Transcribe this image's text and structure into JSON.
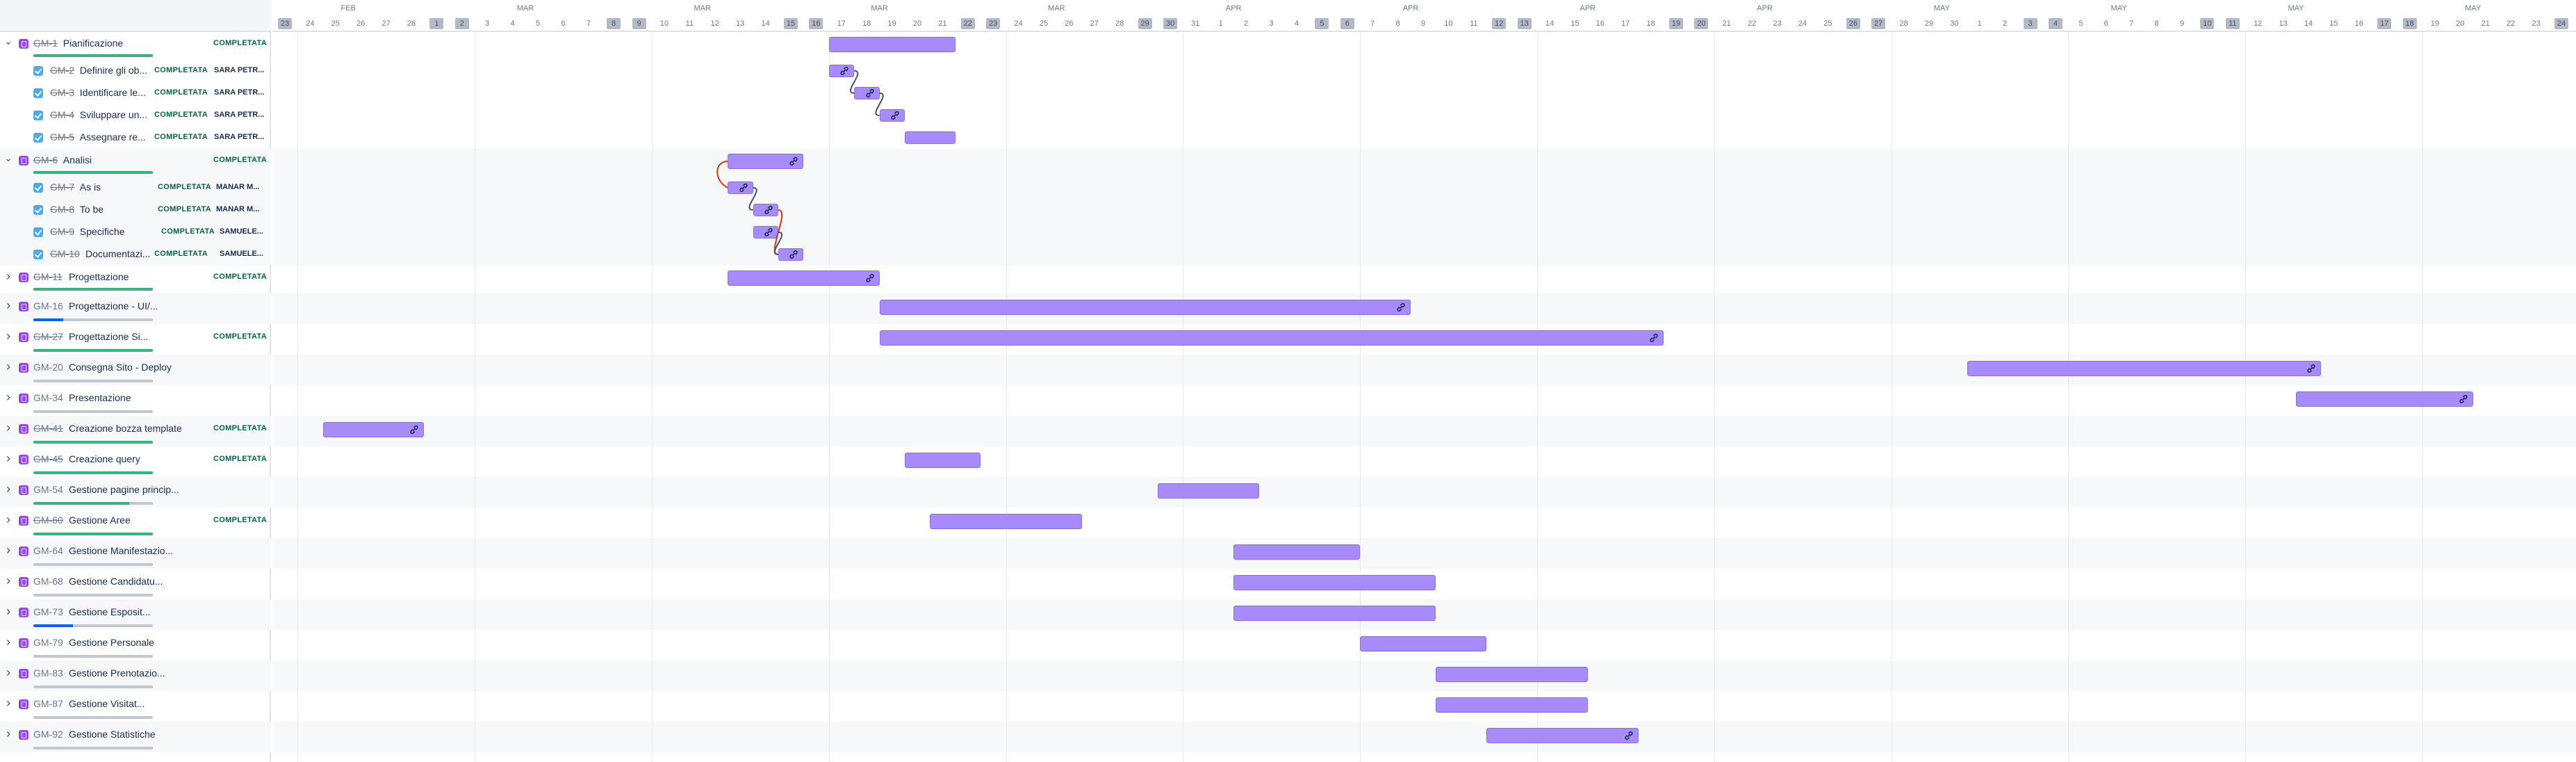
{
  "timeline": {
    "months": [
      "FEB",
      "MAR",
      "MAR",
      "MAR",
      "APR",
      "APR",
      "APR",
      "MAY",
      "MAY",
      "MAY"
    ],
    "days": [
      "23",
      "24",
      "25",
      "26",
      "27",
      "28",
      "1",
      "2",
      "3",
      "4",
      "5",
      "6",
      "7",
      "8",
      "9",
      "10",
      "11",
      "12",
      "13",
      "14",
      "15",
      "16",
      "17",
      "18",
      "19",
      "20",
      "21",
      "22",
      "23",
      "24",
      "25",
      "26",
      "27",
      "28",
      "29",
      "30",
      "31",
      "1",
      "2",
      "3",
      "4",
      "5",
      "6",
      "7",
      "8",
      "9",
      "10",
      "11",
      "12",
      "13",
      "14",
      "15",
      "16",
      "17",
      "18",
      "19",
      "20",
      "21",
      "22",
      "23",
      "24",
      "25",
      "26",
      "27",
      "28",
      "29",
      "30",
      "1",
      "2",
      "3",
      "4",
      "5",
      "6",
      "7",
      "8",
      "9",
      "10",
      "11",
      "12",
      "13",
      "14",
      "15",
      "16",
      "17",
      "18",
      "19",
      "20",
      "21",
      "22",
      "23",
      "24"
    ]
  },
  "issues": [
    {
      "key": "GM-1",
      "title": "Pianificazione",
      "status": "COMPLETATA",
      "assignee": "",
      "level": 0,
      "expanded": true,
      "resolved": true,
      "progress": 1.0
    },
    {
      "key": "GM-2",
      "title": "Definire gli ob...",
      "status": "COMPLETATA",
      "assignee": "SARA PETR...",
      "level": 1,
      "resolved": true
    },
    {
      "key": "GM-3",
      "title": "Identificare le...",
      "status": "COMPLETATA",
      "assignee": "SARA PETR...",
      "level": 1,
      "resolved": true
    },
    {
      "key": "GM-4",
      "title": "Sviluppare un...",
      "status": "COMPLETATA",
      "assignee": "SARA PETR...",
      "level": 1,
      "resolved": true
    },
    {
      "key": "GM-5",
      "title": "Assegnare re...",
      "status": "COMPLETATA",
      "assignee": "SARA PETR...",
      "level": 1,
      "resolved": true
    },
    {
      "key": "GM-6",
      "title": "Analisi",
      "status": "COMPLETATA",
      "assignee": "",
      "level": 0,
      "expanded": true,
      "resolved": true,
      "progress": 1.0
    },
    {
      "key": "GM-7",
      "title": "As is",
      "status": "COMPLETATA",
      "assignee": "MANAR M...",
      "level": 1,
      "resolved": true
    },
    {
      "key": "GM-8",
      "title": "To be",
      "status": "COMPLETATA",
      "assignee": "MANAR M...",
      "level": 1,
      "resolved": true
    },
    {
      "key": "GM-9",
      "title": "Specifiche",
      "status": "COMPLETATA",
      "assignee": "SAMUELE...",
      "level": 1,
      "resolved": true
    },
    {
      "key": "GM-10",
      "title": "Documentazi...",
      "status": "COMPLETATA",
      "assignee": "SAMUELE...",
      "level": 1,
      "resolved": true
    },
    {
      "key": "GM-11",
      "title": "Progettazione",
      "status": "COMPLETATA",
      "assignee": "",
      "level": 0,
      "expanded": false,
      "resolved": true,
      "progress": 1.0
    },
    {
      "key": "GM-16",
      "title": "Progettazione - UI/...",
      "status": "",
      "assignee": "",
      "level": 0,
      "expanded": false,
      "resolved": false,
      "progress": 0.25,
      "progress_color": "blue"
    },
    {
      "key": "GM-27",
      "title": "Progettazione Si...",
      "status": "COMPLETATA",
      "assignee": "",
      "level": 0,
      "expanded": false,
      "resolved": true,
      "progress": 1.0
    },
    {
      "key": "GM-20",
      "title": "Consegna Sito - Deploy",
      "status": "",
      "assignee": "",
      "level": 0,
      "expanded": false,
      "resolved": false,
      "progress": 0
    },
    {
      "key": "GM-34",
      "title": "Presentazione",
      "status": "",
      "assignee": "",
      "level": 0,
      "expanded": false,
      "resolved": false,
      "progress": 0
    },
    {
      "key": "GM-41",
      "title": "Creazione bozza template",
      "status": "COMPLETATA",
      "assignee": "",
      "level": 0,
      "expanded": false,
      "resolved": true,
      "progress": 1.0
    },
    {
      "key": "GM-45",
      "title": "Creazione query",
      "status": "COMPLETATA",
      "assignee": "",
      "level": 0,
      "expanded": false,
      "resolved": true,
      "progress": 1.0
    },
    {
      "key": "GM-54",
      "title": "Gestione pagine princip...",
      "status": "",
      "assignee": "",
      "level": 0,
      "expanded": false,
      "resolved": false,
      "progress": 0.8
    },
    {
      "key": "GM-60",
      "title": "Gestione Aree",
      "status": "COMPLETATA",
      "assignee": "",
      "level": 0,
      "expanded": false,
      "resolved": true,
      "progress": 1.0
    },
    {
      "key": "GM-64",
      "title": "Gestione Manifestazio...",
      "status": "",
      "assignee": "",
      "level": 0,
      "expanded": false,
      "resolved": false,
      "progress": 0
    },
    {
      "key": "GM-68",
      "title": "Gestione Candidatu...",
      "status": "",
      "assignee": "",
      "level": 0,
      "expanded": false,
      "resolved": false,
      "progress": 0
    },
    {
      "key": "GM-73",
      "title": "Gestione Esposit...",
      "status": "",
      "assignee": "",
      "level": 0,
      "expanded": false,
      "resolved": false,
      "progress": 0.33,
      "progress_color": "blue"
    },
    {
      "key": "GM-79",
      "title": "Gestione Personale",
      "status": "",
      "assignee": "",
      "level": 0,
      "expanded": false,
      "resolved": false,
      "progress": 0
    },
    {
      "key": "GM-83",
      "title": "Gestione Prenotazio...",
      "status": "",
      "assignee": "",
      "level": 0,
      "expanded": false,
      "resolved": false,
      "progress": 0
    },
    {
      "key": "GM-87",
      "title": "Gestione Visitat...",
      "status": "",
      "assignee": "",
      "level": 0,
      "expanded": false,
      "resolved": false,
      "progress": 0
    },
    {
      "key": "GM-92",
      "title": "Gestione Statistiche",
      "status": "",
      "assignee": "",
      "level": 0,
      "expanded": false,
      "resolved": false,
      "progress": 0
    }
  ],
  "bars": [
    {
      "key": "GM-1",
      "start": 22,
      "end": 27,
      "link": false
    },
    {
      "key": "GM-2",
      "start": 22,
      "end": 23,
      "link": true
    },
    {
      "key": "GM-3",
      "start": 23,
      "end": 24,
      "link": true
    },
    {
      "key": "GM-4",
      "start": 24,
      "end": 25,
      "link": true
    },
    {
      "key": "GM-5",
      "start": 25,
      "end": 27,
      "link": false
    },
    {
      "key": "GM-6",
      "start": 18,
      "end": 21,
      "link": true
    },
    {
      "key": "GM-7",
      "start": 18,
      "end": 19,
      "link": true
    },
    {
      "key": "GM-8",
      "start": 19,
      "end": 20,
      "link": true
    },
    {
      "key": "GM-9",
      "start": 19,
      "end": 20,
      "link": true
    },
    {
      "key": "GM-10",
      "start": 20,
      "end": 21,
      "link": true
    },
    {
      "key": "GM-11",
      "start": 18,
      "end": 24,
      "link": true
    },
    {
      "key": "GM-16",
      "start": 24,
      "end": 45,
      "link": true
    },
    {
      "key": "GM-27",
      "start": 24,
      "end": 55,
      "link": true
    },
    {
      "key": "GM-20",
      "start": 67,
      "end": 81,
      "link": true
    },
    {
      "key": "GM-34",
      "start": 80,
      "end": 87,
      "link": true
    },
    {
      "key": "GM-41",
      "start": 2,
      "end": 6,
      "link": true
    },
    {
      "key": "GM-45",
      "start": 25,
      "end": 28,
      "link": false
    },
    {
      "key": "GM-54",
      "start": 35,
      "end": 39,
      "link": false
    },
    {
      "key": "GM-60",
      "start": 26,
      "end": 32,
      "link": false
    },
    {
      "key": "GM-64",
      "start": 38,
      "end": 43,
      "link": false
    },
    {
      "key": "GM-68",
      "start": 38,
      "end": 46,
      "link": false
    },
    {
      "key": "GM-73",
      "start": 38,
      "end": 46,
      "link": false
    },
    {
      "key": "GM-79",
      "start": 43,
      "end": 48,
      "link": false
    },
    {
      "key": "GM-83",
      "start": 46,
      "end": 52,
      "link": false
    },
    {
      "key": "GM-87",
      "start": 46,
      "end": 52,
      "link": false
    },
    {
      "key": "GM-92",
      "start": 48,
      "end": 54,
      "link": true
    }
  ],
  "colors": {
    "bar": "#a78bfa",
    "bar_border": "#8b6fe6",
    "done": "#006644",
    "epic": "#904ee2",
    "task": "#4bade8",
    "dependency_ok": "#42526e",
    "dependency_conflict": "#de350b"
  }
}
